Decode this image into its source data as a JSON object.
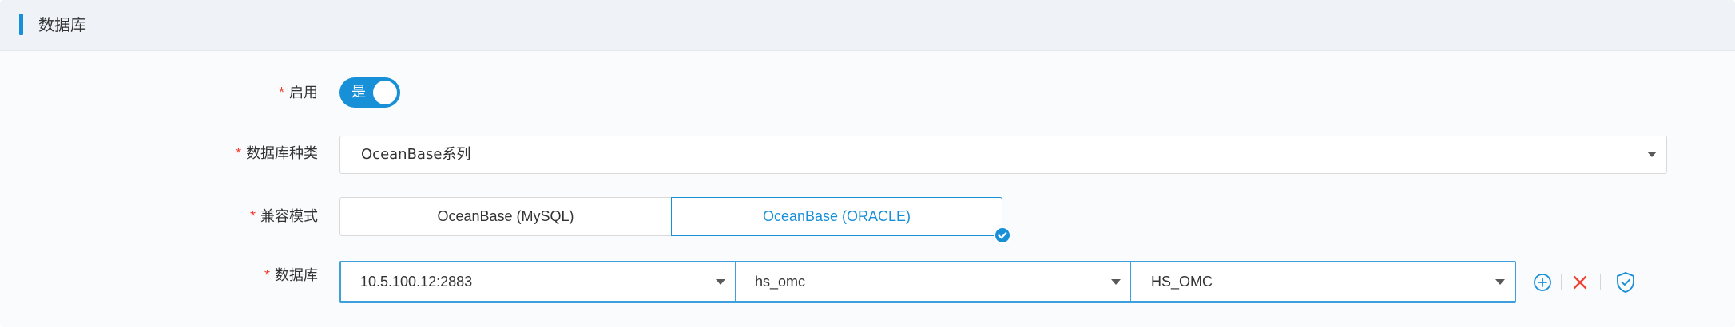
{
  "header": {
    "title": "数据库"
  },
  "form": {
    "enable": {
      "required_mark": "*",
      "label": "启用",
      "toggle_text": "是",
      "on": true
    },
    "db_type": {
      "required_mark": "*",
      "label": "数据库种类",
      "value": "OceanBase系列"
    },
    "compat_mode": {
      "required_mark": "*",
      "label": "兼容模式",
      "options": [
        "OceanBase (MySQL)",
        "OceanBase (ORACLE)"
      ],
      "selected": "OceanBase (ORACLE)"
    },
    "database": {
      "required_mark": "*",
      "label": "数据库",
      "address": "10.5.100.12:2883",
      "user": "hs_omc",
      "schema": "HS_OMC"
    }
  },
  "icons": {
    "add": "plus-circle-icon",
    "remove": "close-icon",
    "verify": "shield-check-icon",
    "selected_check": "check-badge-icon",
    "dropdown": "caret-down-icon"
  },
  "colors": {
    "accent": "#1890d8",
    "required": "#f04134",
    "remove": "#f04134",
    "header_bg": "#eff3f8"
  }
}
